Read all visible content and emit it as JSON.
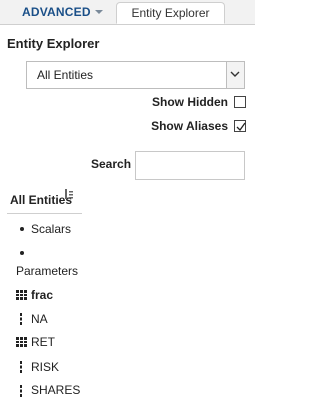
{
  "tabs": {
    "advanced_label": "ADVANCED",
    "explorer_label": "Entity Explorer"
  },
  "panel": {
    "title": "Entity Explorer",
    "select_value": "All Entities",
    "show_hidden_label": "Show Hidden",
    "show_hidden_checked": false,
    "show_aliases_label": "Show Aliases",
    "show_aliases_checked": true,
    "search_label": "Search",
    "search_value": ""
  },
  "tree": {
    "header": "All Entities",
    "items": [
      {
        "label": "Scalars",
        "icon": "bullet"
      },
      {
        "label": "Parameters",
        "icon": "bullet"
      },
      {
        "label": "frac",
        "icon": "grid-icon",
        "bold": true
      },
      {
        "label": "NA",
        "icon": "vertical-dots-icon"
      },
      {
        "label": "RET",
        "icon": "grid-icon"
      },
      {
        "label": "RISK",
        "icon": "vertical-dots-icon"
      },
      {
        "label": "SHARES",
        "icon": "vertical-dots-icon"
      }
    ]
  },
  "colors": {
    "accent": "#1a4f88",
    "tab_bar": "#f2f2f2",
    "border": "#cfcfcf"
  }
}
